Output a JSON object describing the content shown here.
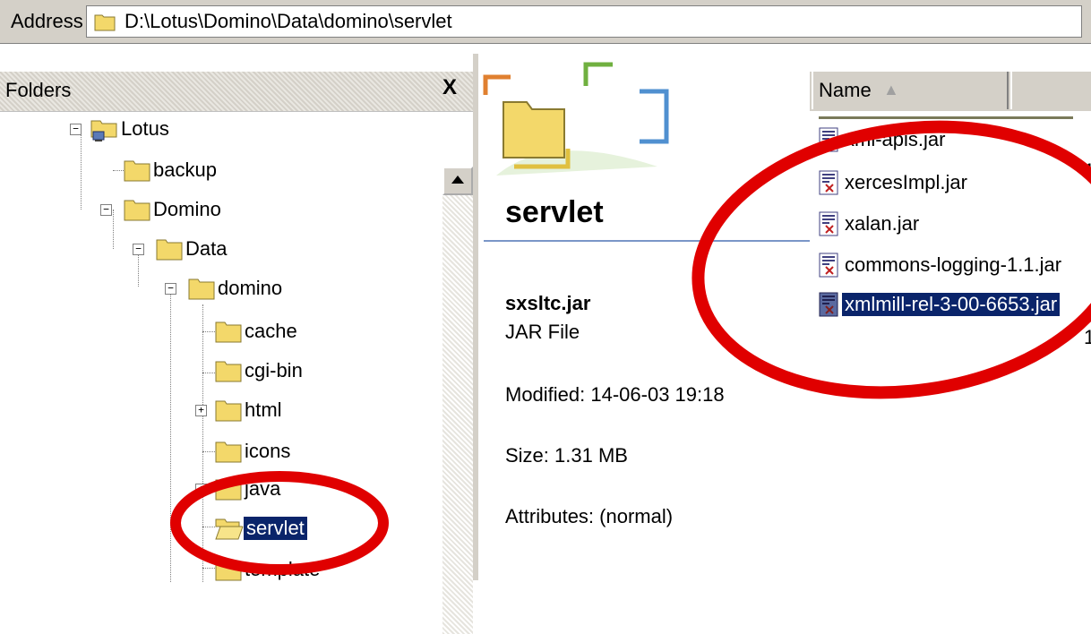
{
  "address_bar": {
    "label": "Address",
    "path": "D:\\Lotus\\Domino\\Data\\domino\\servlet"
  },
  "folders_pane": {
    "title": "Folders",
    "close_label": "X",
    "tree": [
      {
        "label": "Lotus",
        "expander": "−",
        "icon": "network-folder-icon"
      },
      {
        "label": "backup",
        "expander": "",
        "icon": "folder-icon"
      },
      {
        "label": "Domino",
        "expander": "−",
        "icon": "folder-icon"
      },
      {
        "label": "Data",
        "expander": "−",
        "icon": "folder-icon"
      },
      {
        "label": "domino",
        "expander": "−",
        "icon": "folder-icon"
      },
      {
        "label": "cache",
        "expander": "",
        "icon": "folder-icon"
      },
      {
        "label": "cgi-bin",
        "expander": "",
        "icon": "folder-icon"
      },
      {
        "label": "html",
        "expander": "+",
        "icon": "folder-icon"
      },
      {
        "label": "icons",
        "expander": "",
        "icon": "folder-icon"
      },
      {
        "label": "java",
        "expander": "+",
        "icon": "folder-icon"
      },
      {
        "label": "servlet",
        "expander": "",
        "icon": "open-folder-icon",
        "selected": true
      },
      {
        "label": "template",
        "expander": "",
        "icon": "folder-icon"
      }
    ]
  },
  "details_pane": {
    "folder_title": "servlet",
    "file_name": "sxsltc.jar",
    "file_type": "JAR File",
    "modified": "Modified: 14-06-03 19:18",
    "size": "Size: 1.31 MB",
    "attributes": "Attributes: (normal)"
  },
  "file_list": {
    "column_name": "Name",
    "sort_icon": "sort-ascending-icon",
    "files": [
      {
        "name": "xml-apis.jar"
      },
      {
        "name": "xercesImpl.jar"
      },
      {
        "name": "xalan.jar"
      },
      {
        "name": "commons-logging-1.1.jar"
      },
      {
        "name": "xmlmill-rel-3-00-6653.jar",
        "selected": true
      }
    ],
    "truncated_size_glyph": "1"
  },
  "colors": {
    "selection": "#0a246a",
    "chrome": "#d4d0c8",
    "annotation": "#e00000",
    "folder": "#f3d86a"
  }
}
